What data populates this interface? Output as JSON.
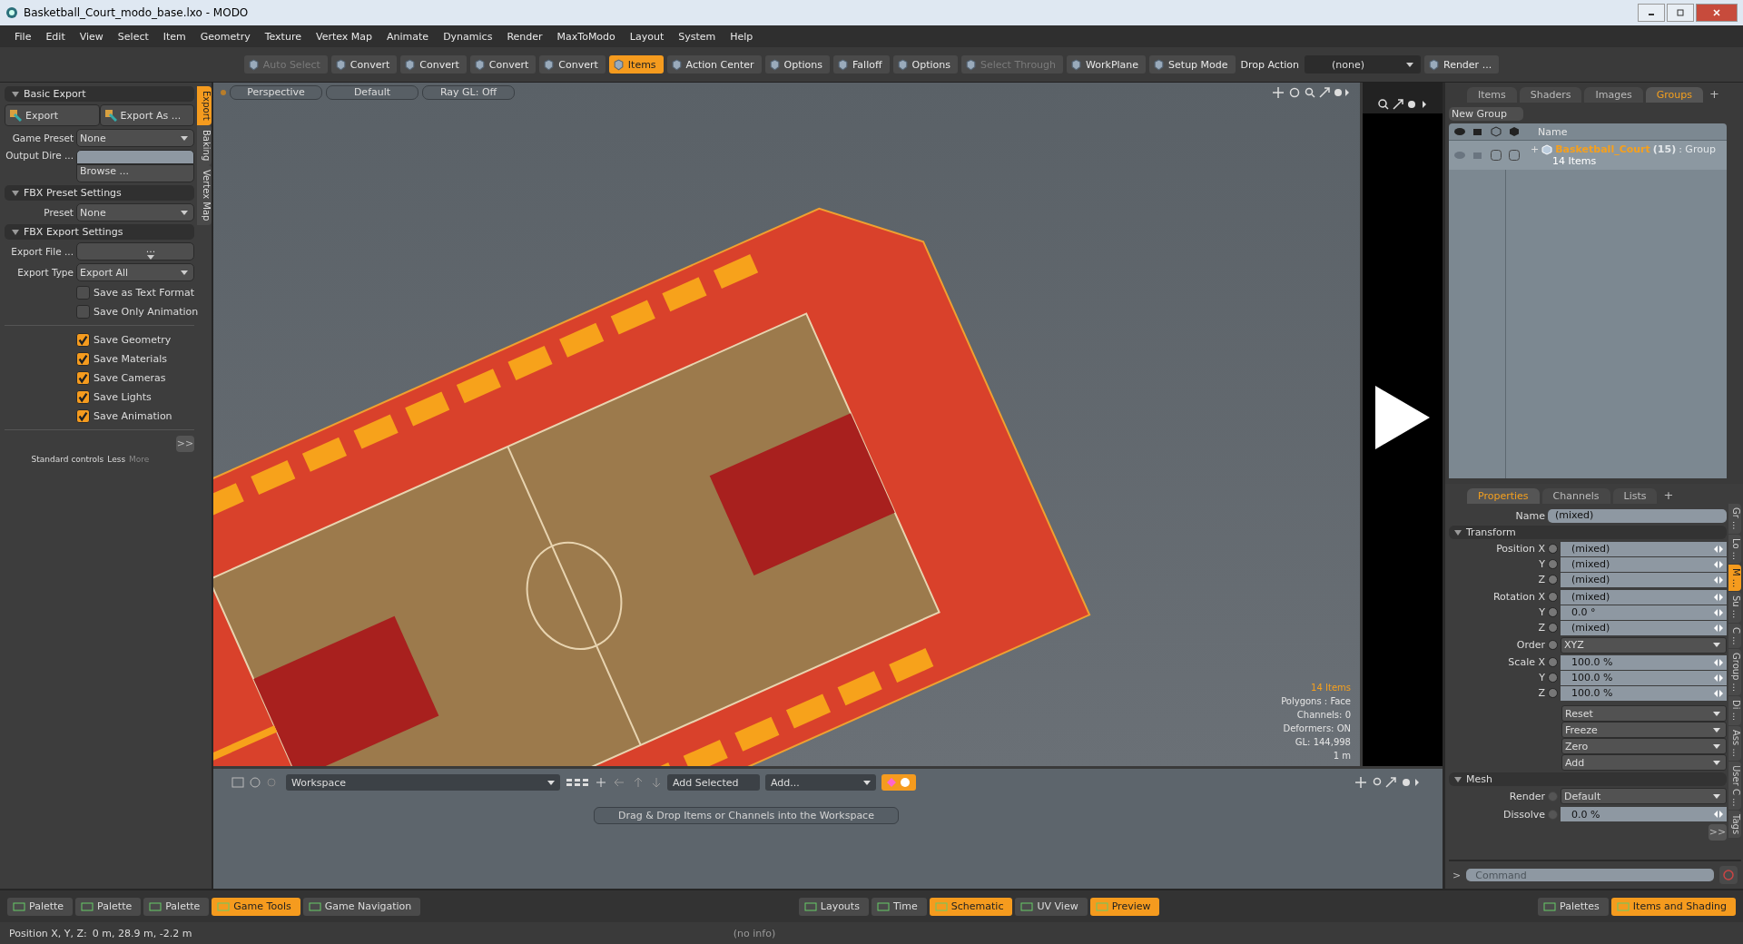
{
  "window": {
    "title": "Basketball_Court_modo_base.lxo - MODO"
  },
  "menu": [
    "File",
    "Edit",
    "View",
    "Select",
    "Item",
    "Geometry",
    "Texture",
    "Vertex Map",
    "Animate",
    "Dynamics",
    "Render",
    "MaxToModo",
    "Layout",
    "System",
    "Help"
  ],
  "toolbar": [
    {
      "label": "Auto Select",
      "kind": "button",
      "disabled": true,
      "selected": false
    },
    {
      "label": "Convert",
      "kind": "button",
      "disabled": false,
      "selected": false
    },
    {
      "label": "Convert",
      "kind": "button",
      "disabled": false,
      "selected": false
    },
    {
      "label": "Convert",
      "kind": "button",
      "disabled": false,
      "selected": false
    },
    {
      "label": "Convert",
      "kind": "button",
      "disabled": false,
      "selected": false
    },
    {
      "label": "Items",
      "kind": "button",
      "disabled": false,
      "selected": true
    },
    {
      "label": "Action Center",
      "kind": "button",
      "disabled": false,
      "selected": false
    },
    {
      "label": "Options",
      "kind": "button",
      "disabled": false,
      "selected": false
    },
    {
      "label": "Falloff",
      "kind": "button",
      "disabled": false,
      "selected": false
    },
    {
      "label": "Options",
      "kind": "button",
      "disabled": false,
      "selected": false
    },
    {
      "label": "Select Through",
      "kind": "button",
      "disabled": true,
      "selected": false
    },
    {
      "label": "WorkPlane",
      "kind": "button",
      "disabled": false,
      "selected": false
    },
    {
      "label": "Setup Mode",
      "kind": "button",
      "disabled": false,
      "selected": false
    },
    {
      "label": "Drop Action",
      "kind": "label"
    },
    {
      "label": "(none)",
      "kind": "dropdown"
    },
    {
      "label": "Render ...",
      "kind": "button",
      "disabled": false,
      "selected": false
    }
  ],
  "left_tabs": [
    {
      "label": "Export",
      "selected": true
    },
    {
      "label": "Baking",
      "selected": false
    },
    {
      "label": "Vertex Map",
      "selected": false
    }
  ],
  "basic_export": {
    "title": "Basic Export",
    "buttons": [
      "Export",
      "Export As ..."
    ],
    "game_preset": {
      "label": "Game Preset",
      "value": "None"
    },
    "output_dir": {
      "label": "Output Dire ...",
      "button": "Browse ..."
    }
  },
  "fbx_preset": {
    "title": "FBX Preset Settings",
    "label": "Preset",
    "value": "None"
  },
  "fbx_export": {
    "title": "FBX Export Settings",
    "export_file": {
      "label": "Export File  ...",
      "value": "..."
    },
    "export_type": {
      "label": "Export Type",
      "value": "Export All"
    },
    "format_options": [
      {
        "label": "Save as Text Format",
        "checked": false
      },
      {
        "label": "Save Only Animation",
        "checked": false
      }
    ],
    "save_options": [
      {
        "label": "Save Geometry",
        "checked": true
      },
      {
        "label": "Save Materials",
        "checked": true
      },
      {
        "label": "Save Cameras",
        "checked": true
      },
      {
        "label": "Save Lights",
        "checked": true
      },
      {
        "label": "Save Animation",
        "checked": true
      }
    ],
    "more_button": ">>",
    "footer": {
      "standard": "Standard controls",
      "less": "Less",
      "more": "More"
    }
  },
  "viewport": {
    "buttons": [
      "Perspective",
      "Default",
      "Ray GL: Off"
    ],
    "info": [
      {
        "text": "14 Items",
        "kind": "highlight"
      },
      {
        "text": "Polygons : Face",
        "kind": "plain"
      },
      {
        "text": "Channels: 0",
        "kind": "plain"
      },
      {
        "text": "Deformers: ON",
        "kind": "plain"
      },
      {
        "text": "GL: 144,998",
        "kind": "plain"
      },
      {
        "text": "1 m",
        "kind": "plain"
      }
    ]
  },
  "workspace": {
    "dropdown": "Workspace",
    "add_selected": "Add Selected",
    "add": "Add...",
    "hint": "Drag & Drop Items or Channels into the Workspace"
  },
  "items_panel": {
    "tabs": [
      {
        "label": "Items",
        "selected": false
      },
      {
        "label": "Shaders",
        "selected": false
      },
      {
        "label": "Images",
        "selected": false
      },
      {
        "label": "Groups",
        "selected": true
      }
    ],
    "plus": "+",
    "new_group": "New Group",
    "column": "Name",
    "group": {
      "expander": "+",
      "name": "Basketball_Court",
      "count": "(15)",
      "type": ": Group",
      "items": "14 Items"
    }
  },
  "properties": {
    "tabs": [
      {
        "label": "Properties",
        "selected": true
      },
      {
        "label": "Channels",
        "selected": false
      },
      {
        "label": "Lists",
        "selected": false
      }
    ],
    "plus": "+",
    "name": {
      "label": "Name",
      "value": "(mixed)"
    },
    "transform_title": "Transform",
    "transform_groups": [
      {
        "kind": "number",
        "rows": [
          {
            "label": "Position X",
            "value": "(mixed)"
          },
          {
            "label": "Y",
            "value": "(mixed)"
          },
          {
            "label": "Z",
            "value": "(mixed)"
          }
        ]
      },
      {
        "kind": "number",
        "rows": [
          {
            "label": "Rotation X",
            "value": "(mixed)"
          },
          {
            "label": "Y",
            "value": "0.0 °"
          },
          {
            "label": "Z",
            "value": "(mixed)"
          }
        ]
      },
      {
        "kind": "dropdown",
        "rows": [
          {
            "label": "Order",
            "value": "XYZ"
          }
        ]
      },
      {
        "kind": "number",
        "rows": [
          {
            "label": "Scale X",
            "value": "100.0 %"
          },
          {
            "label": "Y",
            "value": "100.0 %"
          },
          {
            "label": "Z",
            "value": "100.0 %"
          }
        ]
      }
    ],
    "actions": [
      "Reset",
      "Freeze",
      "Zero",
      "Add"
    ],
    "mesh_title": "Mesh",
    "render": {
      "label": "Render",
      "value": "Default"
    },
    "dissolve": {
      "label": "Dissolve",
      "value": "0.0 %"
    },
    "more_button": ">>",
    "side_tabs": [
      {
        "label": "Gr ...",
        "selected": false
      },
      {
        "label": "Lo ...",
        "selected": false
      },
      {
        "label": "M ...",
        "selected": true
      },
      {
        "label": "Su ...",
        "selected": false
      },
      {
        "label": "C ...",
        "selected": false
      },
      {
        "label": "Group ...",
        "selected": false
      },
      {
        "label": "Di ...",
        "selected": false
      },
      {
        "label": "Ass ...",
        "selected": false
      },
      {
        "label": "User C ...",
        "selected": false
      },
      {
        "label": "Tags",
        "selected": false
      }
    ],
    "command": {
      "prompt": ">",
      "placeholder": "Command"
    }
  },
  "bottom_bar": {
    "left": [
      {
        "label": "Palette",
        "selected": false
      },
      {
        "label": "Palette",
        "selected": false
      },
      {
        "label": "Palette",
        "selected": false
      },
      {
        "label": "Game Tools",
        "selected": true
      },
      {
        "label": "Game Navigation",
        "selected": false
      }
    ],
    "center": [
      {
        "label": "Layouts",
        "selected": false
      },
      {
        "label": "Time",
        "selected": false
      },
      {
        "label": "Schematic",
        "selected": true
      },
      {
        "label": "UV View",
        "selected": false
      },
      {
        "label": "Preview",
        "selected": true
      }
    ],
    "right": [
      {
        "label": "Palettes",
        "selected": false
      },
      {
        "label": "Items and Shading",
        "selected": true
      }
    ]
  },
  "status_bar": {
    "label": "Position X, Y, Z:",
    "value": "0 m, 28.9 m, -2.2 m",
    "info": "(no info)"
  }
}
